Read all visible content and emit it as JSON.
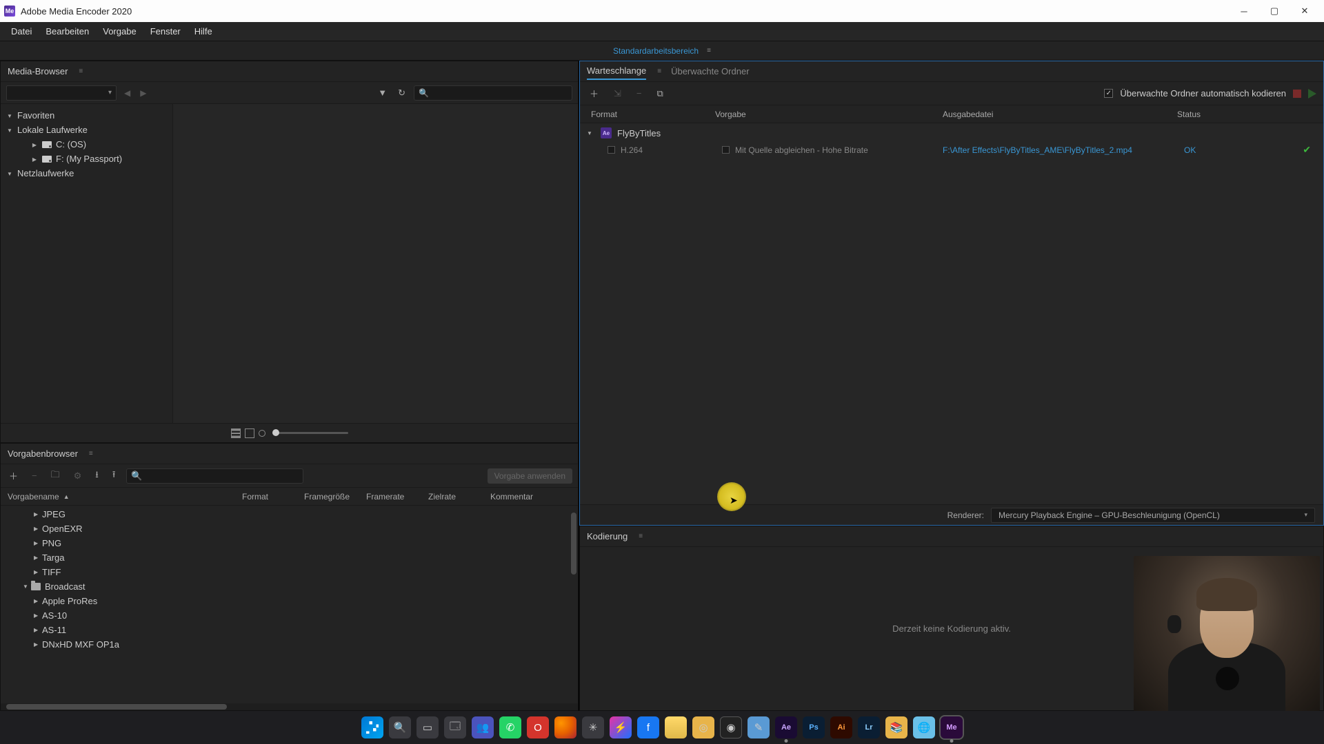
{
  "titlebar": {
    "title": "Adobe Media Encoder 2020"
  },
  "menu": {
    "items": [
      "Datei",
      "Bearbeiten",
      "Vorgabe",
      "Fenster",
      "Hilfe"
    ]
  },
  "workspace": {
    "label": "Standardarbeitsbereich"
  },
  "mediaBrowser": {
    "title": "Media-Browser",
    "tree": {
      "favorites": "Favoriten",
      "localDrives": "Lokale Laufwerke",
      "drives": [
        "C: (OS)",
        "F: (My Passport)"
      ],
      "network": "Netzlaufwerke"
    }
  },
  "presetBrowser": {
    "title": "Vorgabenbrowser",
    "applyBtn": "Vorgabe anwenden",
    "headers": {
      "name": "Vorgabename",
      "format": "Format",
      "frameSize": "Framegröße",
      "frameRate": "Framerate",
      "targetRate": "Zielrate",
      "comment": "Kommentar"
    },
    "rows": [
      "JPEG",
      "OpenEXR",
      "PNG",
      "Targa",
      "TIFF"
    ],
    "group": "Broadcast",
    "groupRows": [
      "Apple ProRes",
      "AS-10",
      "AS-11",
      "DNxHD MXF OP1a"
    ]
  },
  "queue": {
    "tabs": {
      "queue": "Warteschlange",
      "watch": "Überwachte Ordner"
    },
    "autoEncode": "Überwachte Ordner automatisch kodieren",
    "headers": {
      "format": "Format",
      "preset": "Vorgabe",
      "output": "Ausgabedatei",
      "status": "Status"
    },
    "job": {
      "name": "FlyByTitles",
      "format": "H.264",
      "preset": "Mit Quelle abgleichen - Hohe Bitrate",
      "output": "F:\\After Effects\\FlyByTitles_AME\\FlyByTitles_2.mp4",
      "ok": "OK"
    },
    "rendererLabel": "Renderer:",
    "renderer": "Mercury Playback Engine – GPU-Beschleunigung (OpenCL)"
  },
  "encoding": {
    "title": "Kodierung",
    "idle": "Derzeit keine Kodierung aktiv."
  },
  "taskbar": {
    "icons": [
      "windows",
      "search",
      "tasks",
      "explorer",
      "teams",
      "whatsapp",
      "opera",
      "firefox",
      "app1",
      "messenger",
      "facebook",
      "folder",
      "app2",
      "obs",
      "notes",
      "ae",
      "ps",
      "ai",
      "lr",
      "app3",
      "app4",
      "me"
    ]
  }
}
